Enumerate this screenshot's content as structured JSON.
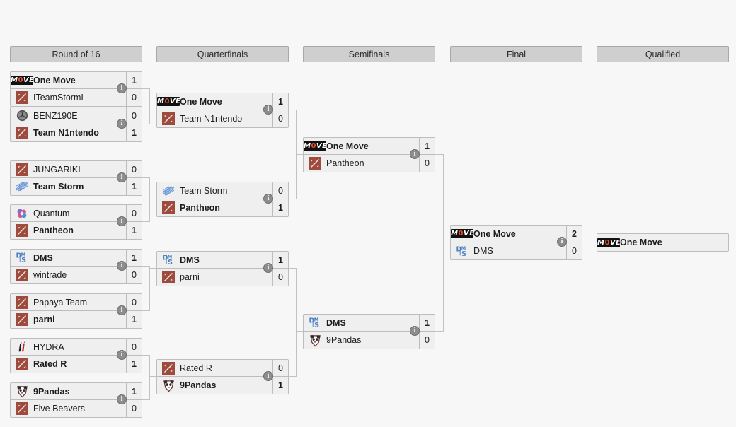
{
  "view": {
    "title": "Tournament Bracket",
    "info_badge_glyph": "i",
    "colors": {
      "header_bg": "#cfcfcf",
      "header_border": "#a8a8a8",
      "box_bg": "#efefef",
      "box_border": "#bdbdbd",
      "connector": "#c2c2c2",
      "page_bg": "#f7f7f7",
      "dota_logo_red": "#9e4a3c",
      "dms_logo_blue": "#4a7fc1",
      "move_logo_black": "#111111",
      "move_logo_orange": "#e8502a"
    }
  },
  "rounds": [
    {
      "label": "Round of 16"
    },
    {
      "label": "Quarterfinals"
    },
    {
      "label": "Semifinals"
    },
    {
      "label": "Final"
    },
    {
      "label": "Qualified"
    }
  ],
  "matches": {
    "r16": [
      {
        "id": "r16-m1",
        "top": {
          "name": "One Move",
          "score": "1",
          "winner": true,
          "logo": "one-move-logo"
        },
        "bottom": {
          "name": "ITeamStormI",
          "score": "0",
          "winner": false,
          "logo": "dota2-default-logo"
        }
      },
      {
        "id": "r16-m2",
        "top": {
          "name": "BENZ190E",
          "score": "0",
          "winner": false,
          "logo": "mercedes-star-logo"
        },
        "bottom": {
          "name": "Team N1ntendo",
          "score": "1",
          "winner": true,
          "logo": "dota2-default-logo"
        }
      },
      {
        "id": "r16-m3",
        "top": {
          "name": "JUNGARIKI",
          "score": "0",
          "winner": false,
          "logo": "dota2-default-logo"
        },
        "bottom": {
          "name": "Team Storm",
          "score": "1",
          "winner": true,
          "logo": "team-storm-logo"
        }
      },
      {
        "id": "r16-m4",
        "top": {
          "name": "Quantum",
          "score": "0",
          "winner": false,
          "logo": "quantum-logo"
        },
        "bottom": {
          "name": "Pantheon",
          "score": "1",
          "winner": true,
          "logo": "dota2-default-logo"
        }
      },
      {
        "id": "r16-m5",
        "top": {
          "name": "DMS",
          "score": "1",
          "winner": true,
          "logo": "dms-logo"
        },
        "bottom": {
          "name": "wintrade",
          "score": "0",
          "winner": false,
          "logo": "dota2-default-logo"
        }
      },
      {
        "id": "r16-m6",
        "top": {
          "name": "Papaya Team",
          "score": "0",
          "winner": false,
          "logo": "dota2-default-logo"
        },
        "bottom": {
          "name": "parni",
          "score": "1",
          "winner": true,
          "logo": "dota2-default-logo"
        }
      },
      {
        "id": "r16-m7",
        "top": {
          "name": "HYDRA",
          "score": "0",
          "winner": false,
          "logo": "hydra-logo"
        },
        "bottom": {
          "name": "Rated R",
          "score": "1",
          "winner": true,
          "logo": "dota2-default-logo"
        }
      },
      {
        "id": "r16-m8",
        "top": {
          "name": "9Pandas",
          "score": "1",
          "winner": true,
          "logo": "9pandas-logo"
        },
        "bottom": {
          "name": "Five Beavers",
          "score": "0",
          "winner": false,
          "logo": "dota2-default-logo"
        }
      }
    ],
    "qf": [
      {
        "id": "qf-m1",
        "top": {
          "name": "One Move",
          "score": "1",
          "winner": true,
          "logo": "one-move-logo"
        },
        "bottom": {
          "name": "Team N1ntendo",
          "score": "0",
          "winner": false,
          "logo": "dota2-default-logo"
        }
      },
      {
        "id": "qf-m2",
        "top": {
          "name": "Team Storm",
          "score": "0",
          "winner": false,
          "logo": "team-storm-logo"
        },
        "bottom": {
          "name": "Pantheon",
          "score": "1",
          "winner": true,
          "logo": "dota2-default-logo"
        }
      },
      {
        "id": "qf-m3",
        "top": {
          "name": "DMS",
          "score": "1",
          "winner": true,
          "logo": "dms-logo"
        },
        "bottom": {
          "name": "parni",
          "score": "0",
          "winner": false,
          "logo": "dota2-default-logo"
        }
      },
      {
        "id": "qf-m4",
        "top": {
          "name": "Rated R",
          "score": "0",
          "winner": false,
          "logo": "dota2-default-logo"
        },
        "bottom": {
          "name": "9Pandas",
          "score": "1",
          "winner": true,
          "logo": "9pandas-logo"
        }
      }
    ],
    "sf": [
      {
        "id": "sf-m1",
        "top": {
          "name": "One Move",
          "score": "1",
          "winner": true,
          "logo": "one-move-logo"
        },
        "bottom": {
          "name": "Pantheon",
          "score": "0",
          "winner": false,
          "logo": "dota2-default-logo"
        }
      },
      {
        "id": "sf-m2",
        "top": {
          "name": "DMS",
          "score": "1",
          "winner": true,
          "logo": "dms-logo"
        },
        "bottom": {
          "name": "9Pandas",
          "score": "0",
          "winner": false,
          "logo": "9pandas-logo"
        }
      }
    ],
    "final": [
      {
        "id": "final-m1",
        "top": {
          "name": "One Move",
          "score": "2",
          "winner": true,
          "logo": "one-move-logo"
        },
        "bottom": {
          "name": "DMS",
          "score": "0",
          "winner": false,
          "logo": "dms-logo"
        }
      }
    ],
    "qualified": [
      {
        "id": "qualified-m1",
        "top": {
          "name": "One Move",
          "score": "",
          "winner": true,
          "logo": "one-move-logo"
        }
      }
    ]
  },
  "logo_text": {
    "one_move_pre": "M",
    "one_move_accent": "0",
    "one_move_post": "VE"
  }
}
